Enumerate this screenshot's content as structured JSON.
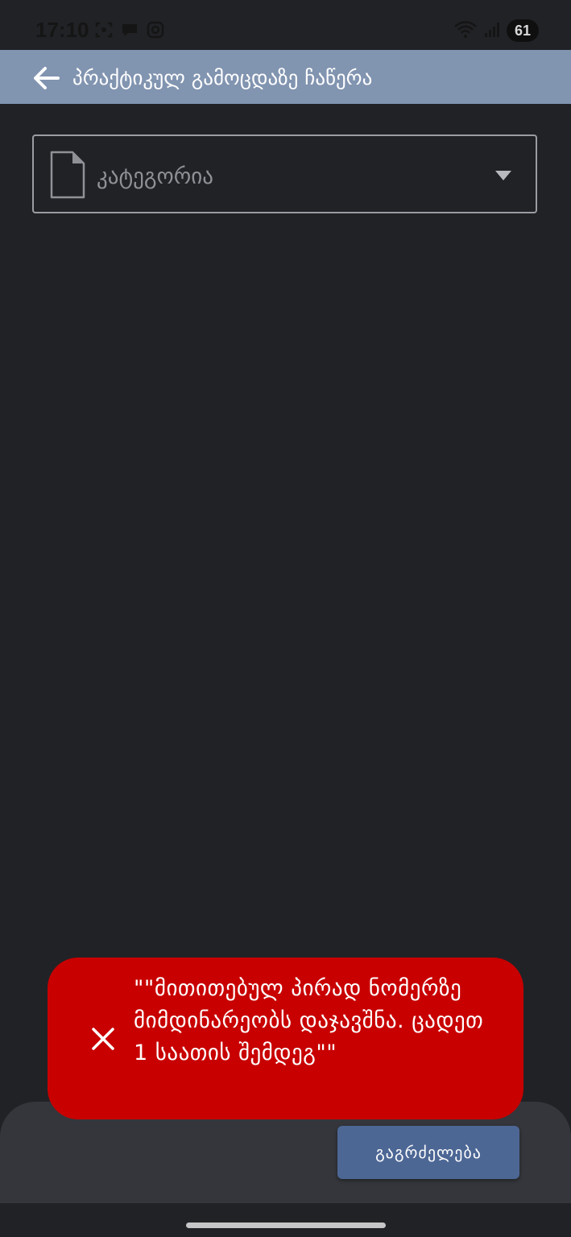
{
  "status_bar": {
    "time": "17:10",
    "battery": "61"
  },
  "header": {
    "title": "პრაქტიკულ გამოცდაზე ჩაწერა"
  },
  "form": {
    "category_placeholder": "კატეგორია"
  },
  "toast": {
    "message": "\"\"მითითებულ პირად ნომერზე მიმდინარეობს დაჯავშნა. ცადეთ 1 საათის შემდეგ\"\""
  },
  "actions": {
    "continue_label": "გაგრძელება"
  },
  "colors": {
    "app_bar": "#8194b0",
    "toast": "#c80000",
    "button": "#4d6795",
    "background": "#212226"
  }
}
